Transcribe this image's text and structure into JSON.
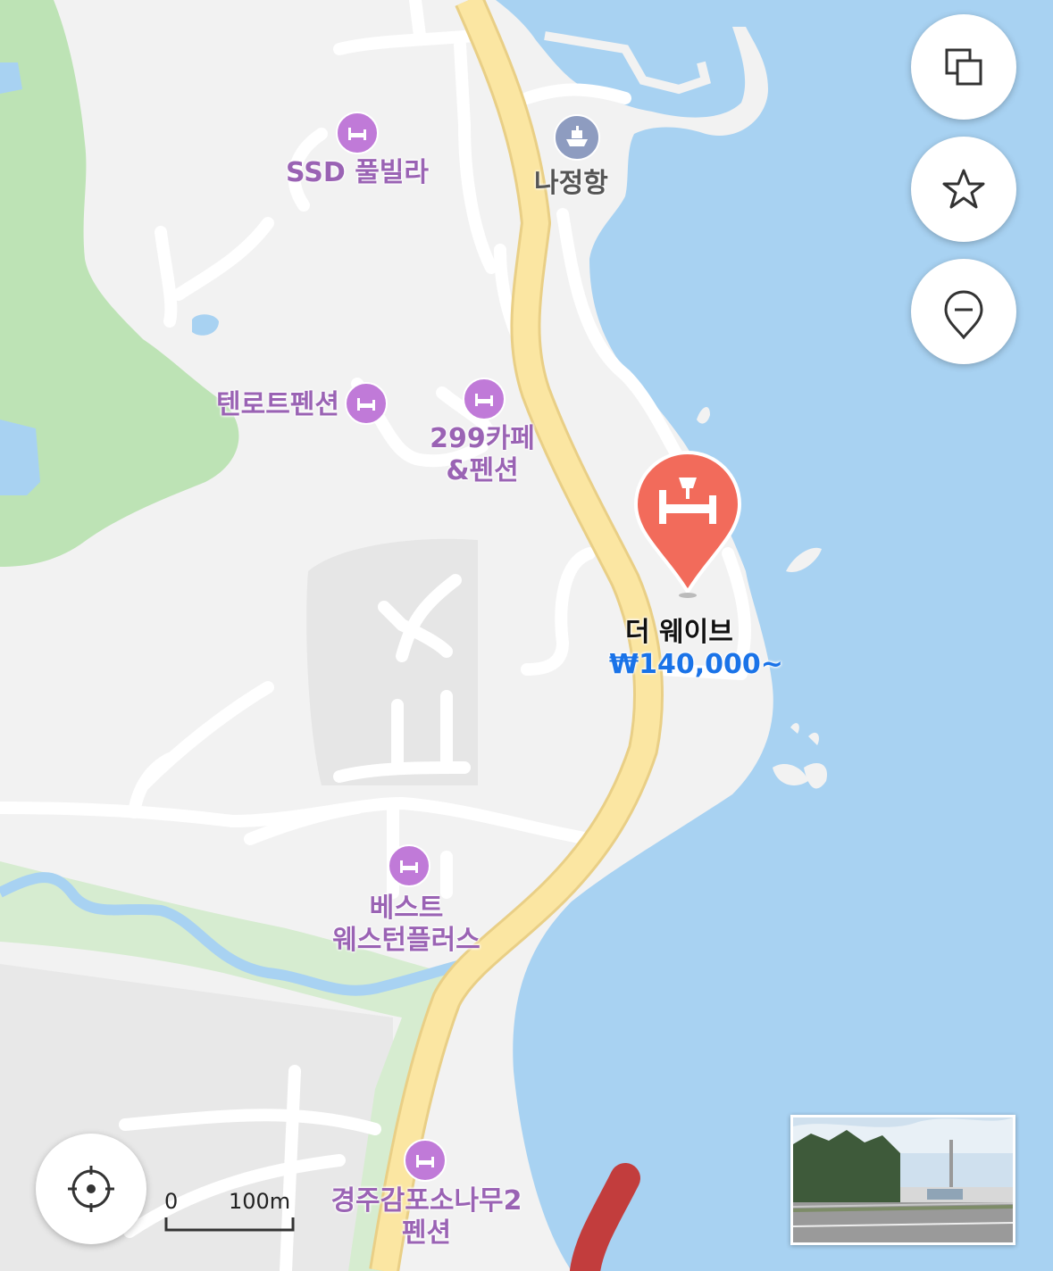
{
  "map": {
    "colors": {
      "land": "#f2f2f2",
      "sea": "#a8d2f2",
      "park": "#bde3b5",
      "road": "#fbe6a2",
      "road_edge": "#e9cf86",
      "grey_area": "#e3e3e3",
      "river": "#a8d2f2"
    },
    "pois": [
      {
        "label": "SSD 풀빌라",
        "icon": "bed-icon"
      },
      {
        "label": "텐로트펜션",
        "icon": "bed-icon"
      },
      {
        "label_line1": "299카페",
        "label_line2": "&펜션",
        "icon": "bed-icon"
      },
      {
        "label_line1": "베스트",
        "label_line2": "웨스턴플러스",
        "icon": "bed-icon"
      },
      {
        "label_line1": "경주감포소나무2",
        "label_line2": "펜션",
        "icon": "bed-icon"
      }
    ],
    "port": {
      "label": "나정항",
      "icon": "ferry-icon"
    },
    "selected": {
      "name": "더 웨이브",
      "price": "₩140,000~",
      "icon": "bed-pin-icon",
      "color": "#f26b5b"
    }
  },
  "controls": {
    "layers_icon": "layers-icon",
    "favorite_icon": "star-icon",
    "place_icon": "map-pin-icon",
    "locate_icon": "crosshair-icon"
  },
  "scale": {
    "zero": "0",
    "distance": "100m"
  }
}
